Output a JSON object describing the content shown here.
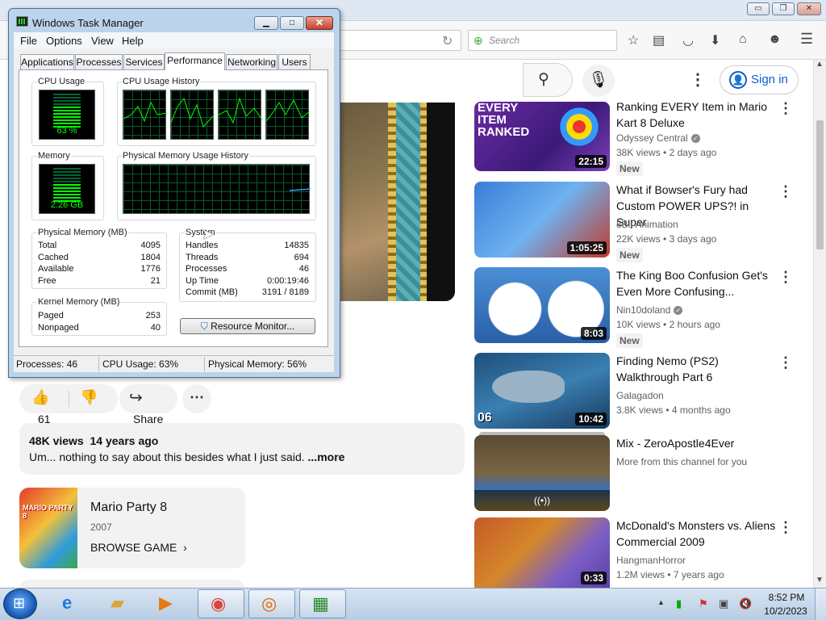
{
  "firefox": {
    "window_buttons": {
      "minimize": "▭",
      "restore": "❐",
      "close": "✕"
    },
    "search_placeholder": "Search",
    "toolbar_icons": [
      "star-icon",
      "reader-icon",
      "pocket-icon",
      "download-icon",
      "home-icon",
      "chat-icon",
      "menu-icon"
    ]
  },
  "youtube": {
    "sign_in": "Sign in",
    "like_count": "61",
    "share_label": "Share",
    "description": {
      "views": "48K views",
      "age": "14 years ago",
      "text": "Um... nothing to say about this besides what I just said.",
      "more": "...more"
    },
    "game": {
      "title": "Mario Party 8",
      "year": "2007",
      "browse": "BROWSE GAME",
      "thumb_text": "MARIO PARTY 8"
    },
    "recommendations": [
      {
        "title": "Ranking EVERY Item in Mario Kart 8 Deluxe",
        "channel": "Odyssey Central",
        "verified": true,
        "views": "38K views",
        "age": "2 days ago",
        "new": "New",
        "duration": "22:15",
        "thumb_text": "EVERY ITEM RANKED"
      },
      {
        "title": "What if Bowser's Fury had Custom POWER UPS?! in Super",
        "channel": "8Bit Animation",
        "verified": false,
        "views": "22K views",
        "age": "3 days ago",
        "new": "New",
        "duration": "1:05:25"
      },
      {
        "title": "The King Boo Confusion Get's Even More Confusing...",
        "channel": "Nin10doland",
        "verified": true,
        "views": "10K views",
        "age": "2 hours ago",
        "new": "New",
        "duration": "8:03"
      },
      {
        "title": "Finding Nemo (PS2) Walkthrough Part 6",
        "channel": "Galagadon",
        "verified": false,
        "views": "3.8K views",
        "age": "4 months ago",
        "new": "",
        "duration": "10:42",
        "thumb_text": "06"
      },
      {
        "title": "Mix - ZeroApostle4Ever",
        "channel": "More from this channel for you",
        "verified": false,
        "views": "",
        "age": "",
        "new": "",
        "duration": ""
      },
      {
        "title": "McDonald's Monsters vs. Aliens Commercial 2009",
        "channel": "HangmanHorror",
        "verified": false,
        "views": "1.2M views",
        "age": "7 years ago",
        "new": "",
        "duration": "0:33"
      }
    ]
  },
  "task_manager": {
    "title": "Windows Task Manager",
    "menu": [
      "File",
      "Options",
      "View",
      "Help"
    ],
    "tabs": [
      "Applications",
      "Processes",
      "Services",
      "Performance",
      "Networking",
      "Users"
    ],
    "selected_tab": "Performance",
    "cpu_usage_label": "CPU Usage",
    "cpu_usage_value": "63 %",
    "cpu_fraction": 0.63,
    "cpu_history_label": "CPU Usage History",
    "memory_label": "Memory",
    "memory_value": "2.26 GB",
    "memory_history_label": "Physical Memory Usage History",
    "physical_memory": {
      "label": "Physical Memory (MB)",
      "rows": [
        {
          "k": "Total",
          "v": "4095"
        },
        {
          "k": "Cached",
          "v": "1804"
        },
        {
          "k": "Available",
          "v": "1776"
        },
        {
          "k": "Free",
          "v": "21"
        }
      ]
    },
    "system": {
      "label": "System",
      "rows": [
        {
          "k": "Handles",
          "v": "14835"
        },
        {
          "k": "Threads",
          "v": "694"
        },
        {
          "k": "Processes",
          "v": "46"
        },
        {
          "k": "Up Time",
          "v": "0:00:19:46"
        },
        {
          "k": "Commit (MB)",
          "v": "3191 / 8189"
        }
      ]
    },
    "kernel_memory": {
      "label": "Kernel Memory (MB)",
      "rows": [
        {
          "k": "Paged",
          "v": "253"
        },
        {
          "k": "Nonpaged",
          "v": "40"
        }
      ]
    },
    "resource_monitor": "Resource Monitor...",
    "status": {
      "processes": "Processes: 46",
      "cpu": "CPU Usage: 63%",
      "memory": "Physical Memory: 56%"
    }
  },
  "taskbar": {
    "apps": [
      "internet-explorer-icon",
      "file-explorer-icon",
      "media-player-icon",
      "chrome-icon",
      "firefox-icon",
      "task-manager-icon"
    ],
    "time": "8:52 PM",
    "date": "10/2/2023"
  }
}
